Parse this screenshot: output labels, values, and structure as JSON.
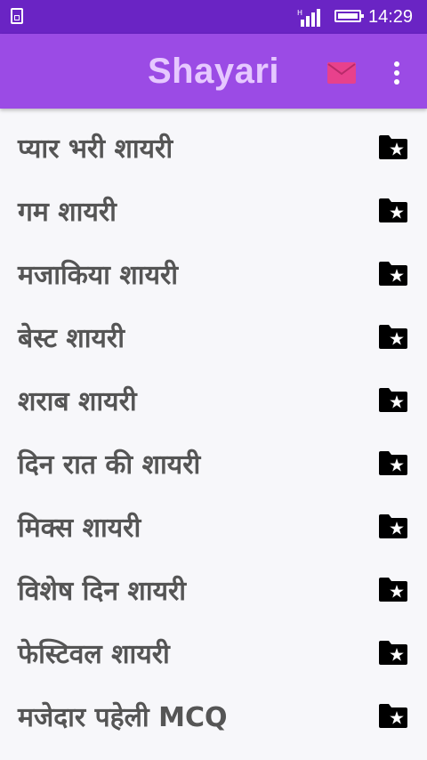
{
  "status_bar": {
    "time": "14:29"
  },
  "app_bar": {
    "title": "Shayari",
    "mail_icon": "mail-icon",
    "more_icon": "more-vert-icon",
    "accent": "#e8418c"
  },
  "list": {
    "item_icon": "folder-star-icon",
    "items": [
      {
        "label": "प्यार भरी शायरी"
      },
      {
        "label": "गम शायरी"
      },
      {
        "label": "मजाकिया शायरी"
      },
      {
        "label": "बेस्ट शायरी"
      },
      {
        "label": "शराब शायरी"
      },
      {
        "label": "दिन रात की शायरी"
      },
      {
        "label": "मिक्स शायरी"
      },
      {
        "label": "विशेष दिन शायरी"
      },
      {
        "label": "फेस्टिवल शायरी"
      },
      {
        "label": "मजेदार पहेली MCQ"
      }
    ]
  },
  "colors": {
    "status_bar": "#6a24c4",
    "app_bar": "#9b4be5",
    "title": "#e6c8ff",
    "list_text": "#555555",
    "background": "#f7f7fa"
  }
}
